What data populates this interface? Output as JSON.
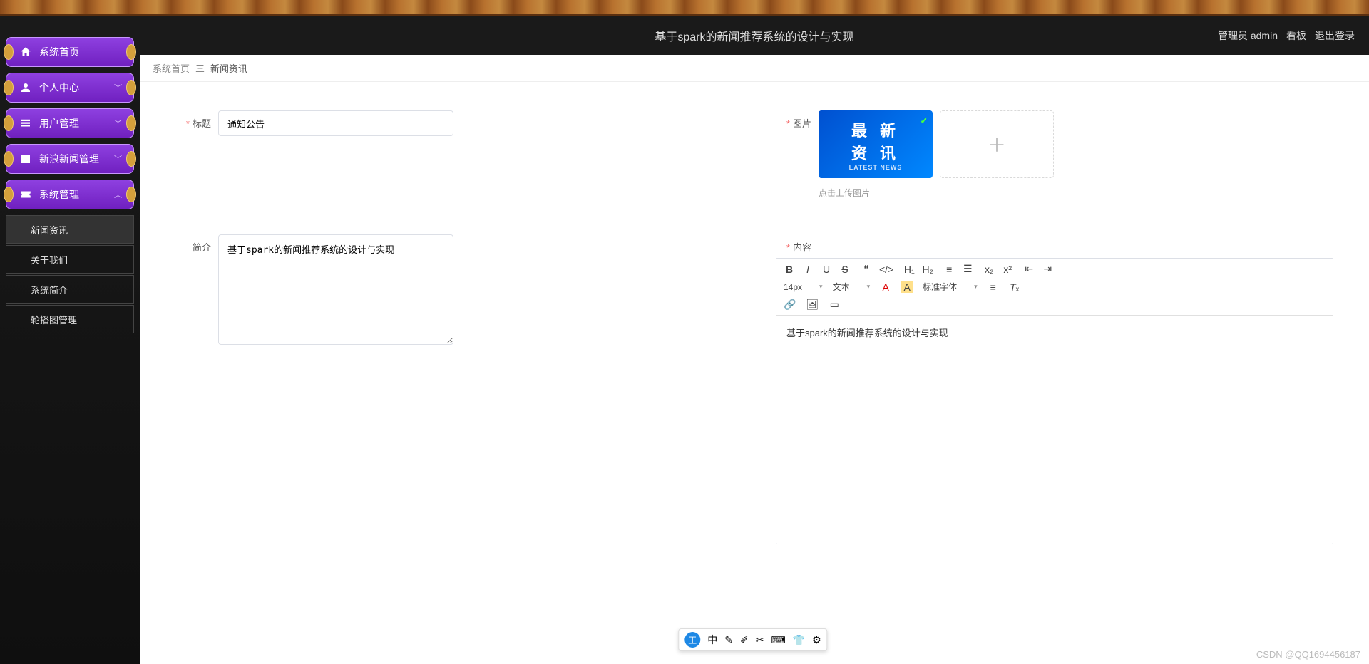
{
  "header": {
    "title": "基于spark的新闻推荐系统的设计与实现",
    "admin_label": "管理员 admin",
    "board": "看板",
    "logout": "退出登录"
  },
  "sidebar": {
    "items": [
      {
        "label": "系统首页",
        "has_arrow": false
      },
      {
        "label": "个人中心",
        "has_arrow": true
      },
      {
        "label": "用户管理",
        "has_arrow": true
      },
      {
        "label": "新浪新闻管理",
        "has_arrow": true
      },
      {
        "label": "系统管理",
        "has_arrow": true
      }
    ],
    "submenu": [
      {
        "label": "新闻资讯",
        "active": true
      },
      {
        "label": "关于我们",
        "active": false
      },
      {
        "label": "系统简介",
        "active": false
      },
      {
        "label": "轮播图管理",
        "active": false
      }
    ]
  },
  "breadcrumb": {
    "home": "系统首页",
    "sep": "三",
    "current": "新闻资讯"
  },
  "form": {
    "title_label": "标题",
    "title_value": "通知公告",
    "summary_label": "简介",
    "summary_value": "基于spark的新闻推荐系统的设计与实现",
    "image_label": "图片",
    "thumb_line1": "最 新",
    "thumb_line2": "资 讯",
    "thumb_sub": "LATEST NEWS",
    "upload_hint": "点击上传图片",
    "content_label": "内容",
    "content_value": "基于spark的新闻推荐系统的设计与实现"
  },
  "editor_toolbar": {
    "font_size": "14px",
    "style": "文本",
    "font_family": "标准字体"
  },
  "float_tools": {
    "badge": "王",
    "ime": "中"
  },
  "watermark": "CSDN @QQ1694456187"
}
